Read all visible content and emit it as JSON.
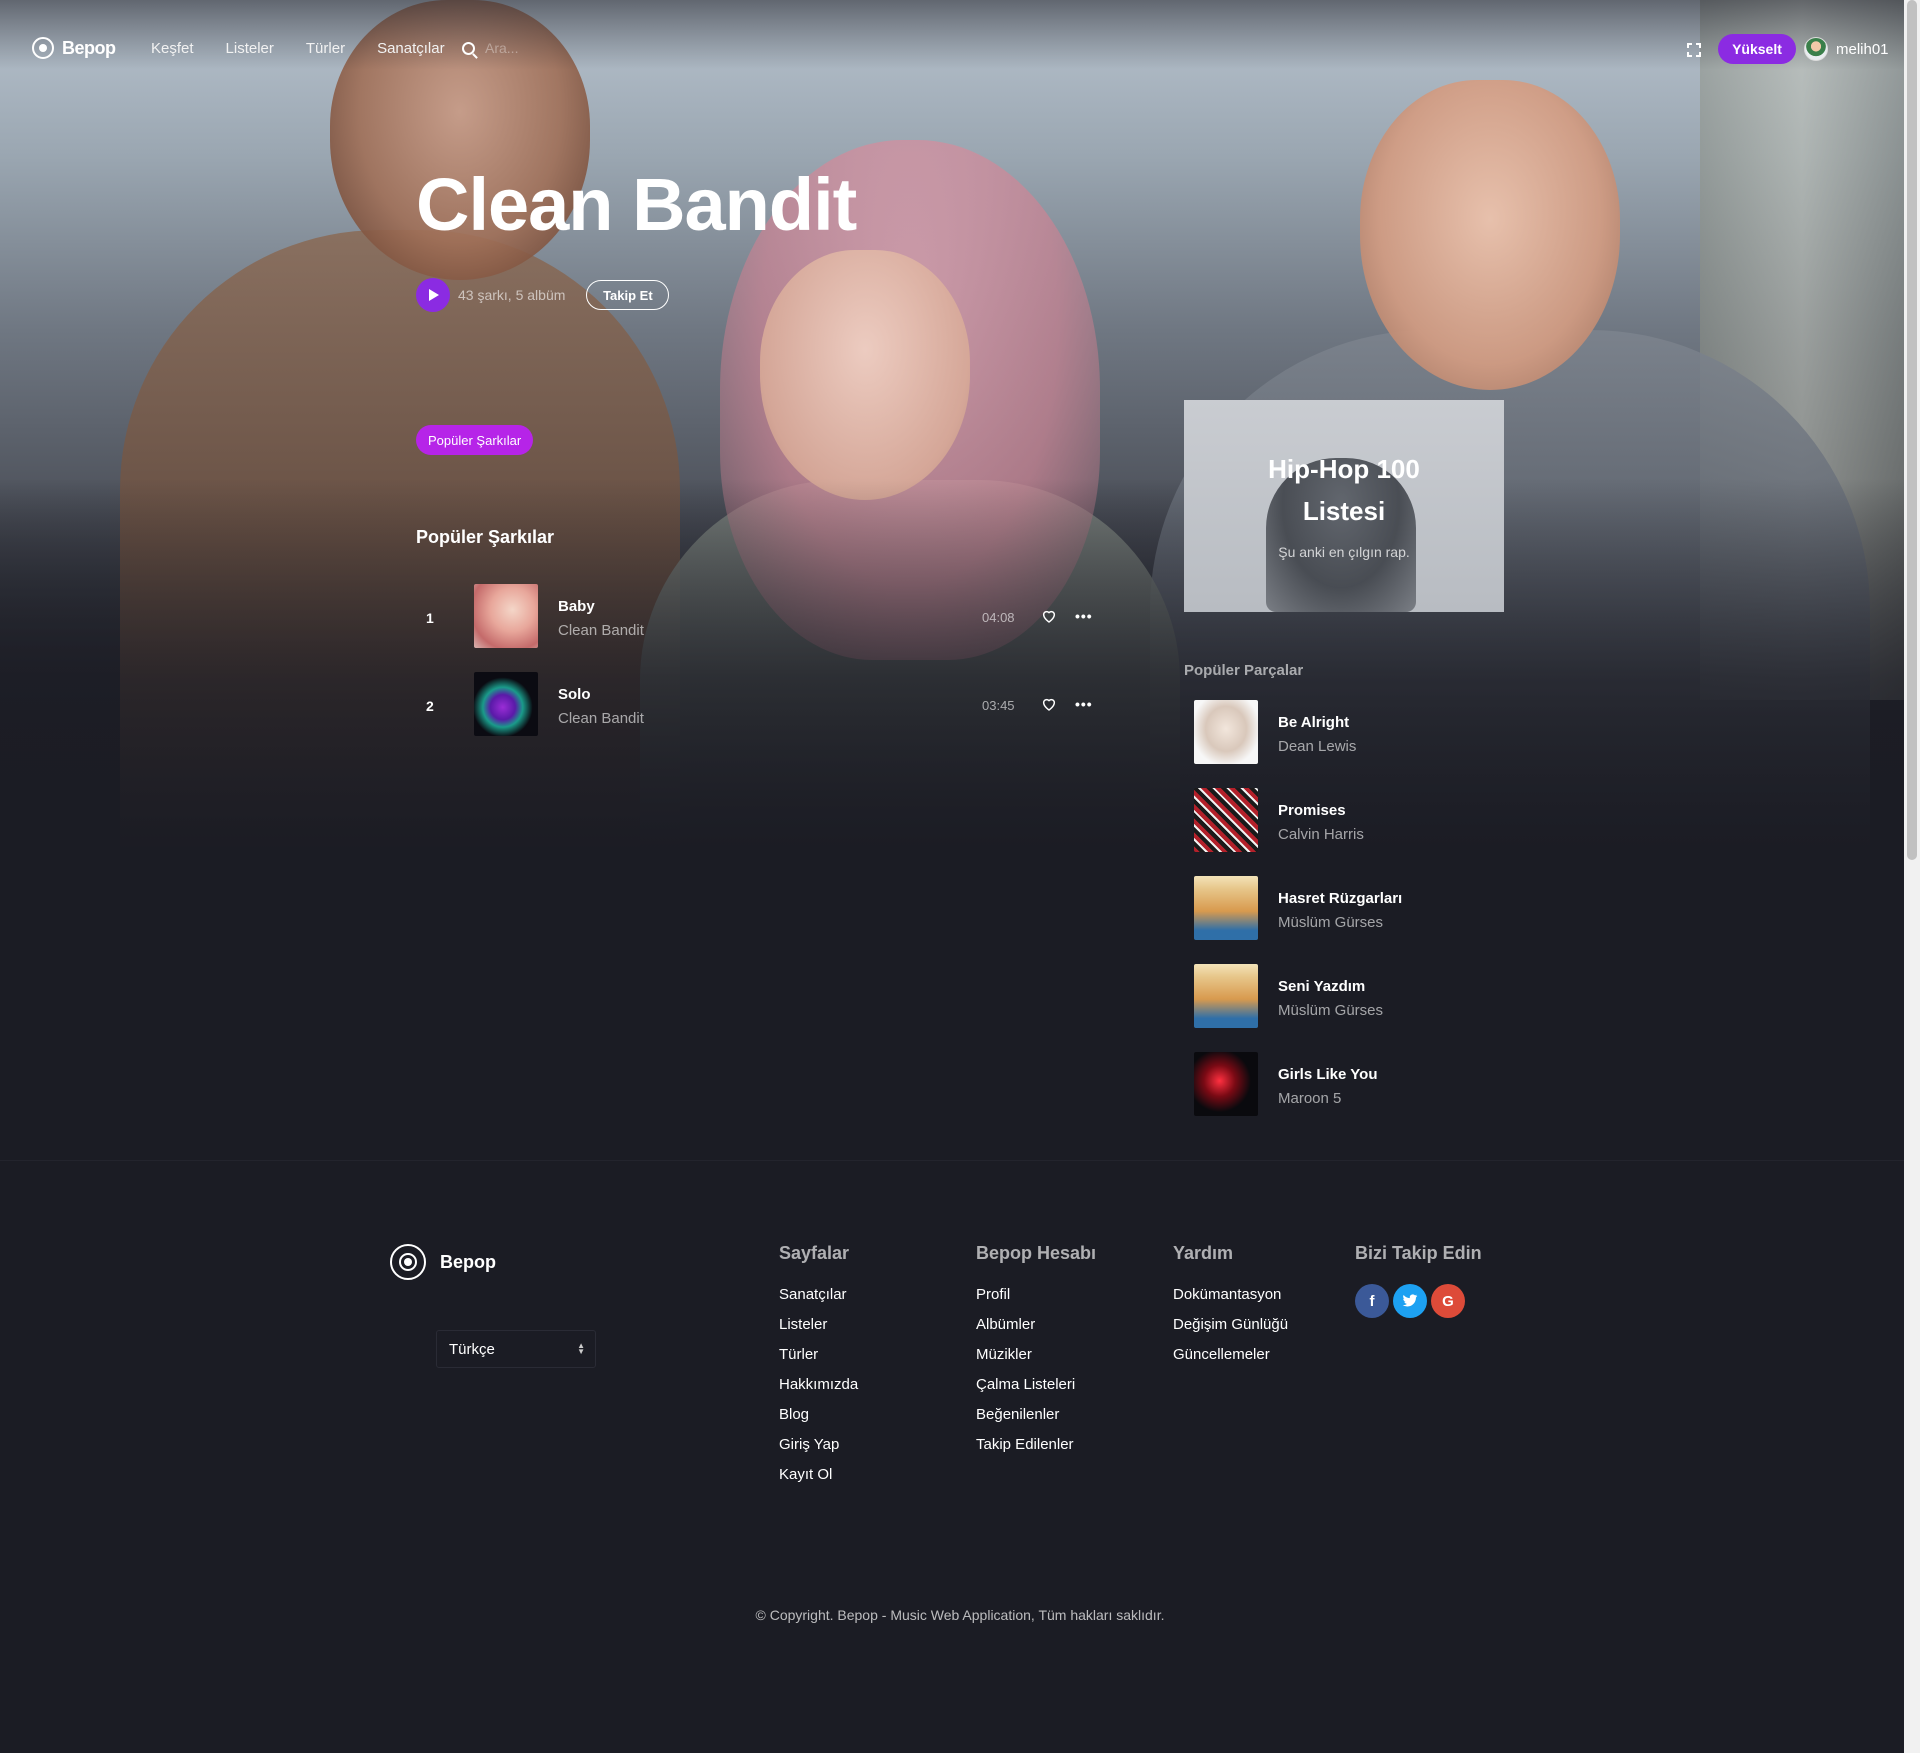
{
  "nav": {
    "logo": "Bepop",
    "links": [
      "Keşfet",
      "Listeler",
      "Türler",
      "Sanatçılar"
    ],
    "search_placeholder": "Ara...",
    "upgrade_label": "Yükselt",
    "username": "melih01"
  },
  "artist": {
    "name": "Clean Bandit",
    "meta": "43 şarkı, 5 albüm",
    "follow_label": "Takip Et",
    "tab_label": "Popüler Şarkılar"
  },
  "popular_songs": {
    "title": "Popüler Şarkılar",
    "tracks": [
      {
        "num": "1",
        "title": "Baby",
        "artist": "Clean Bandit",
        "duration": "04:08"
      },
      {
        "num": "2",
        "title": "Solo",
        "artist": "Clean Bandit",
        "duration": "03:45"
      }
    ]
  },
  "promo": {
    "title": "Hip-Hop 100 Listesi",
    "subtitle": "Şu anki en çılgın rap."
  },
  "popular_tracks": {
    "title": "Popüler Parçalar",
    "items": [
      {
        "title": "Be Alright",
        "artist": "Dean Lewis"
      },
      {
        "title": "Promises",
        "artist": "Calvin Harris"
      },
      {
        "title": "Hasret Rüzgarları",
        "artist": "Müslüm Gürses"
      },
      {
        "title": "Seni Yazdım",
        "artist": "Müslüm Gürses"
      },
      {
        "title": "Girls Like You",
        "artist": "Maroon 5"
      }
    ]
  },
  "footer": {
    "logo": "Bepop",
    "language": "Türkçe",
    "columns": [
      {
        "title": "Sayfalar",
        "links": [
          "Sanatçılar",
          "Listeler",
          "Türler",
          "Hakkımızda",
          "Blog",
          "Giriş Yap",
          "Kayıt Ol"
        ]
      },
      {
        "title": "Bepop Hesabı",
        "links": [
          "Profil",
          "Albümler",
          "Müzikler",
          "Çalma Listeleri",
          "Beğenilenler",
          "Takip Edilenler"
        ]
      },
      {
        "title": "Yardım",
        "links": [
          "Dokümantasyon",
          "Değişim Günlüğü",
          "Güncellemeler"
        ]
      }
    ],
    "social_title": "Bizi Takip Edin",
    "social": [
      "f",
      "t",
      "G"
    ],
    "copyright": "© Copyright. Bepop - Music Web Application, Tüm hakları saklıdır."
  },
  "colors": {
    "accent": "#8b2be2",
    "pill": "#b624e8",
    "background": "#1b1c24"
  }
}
